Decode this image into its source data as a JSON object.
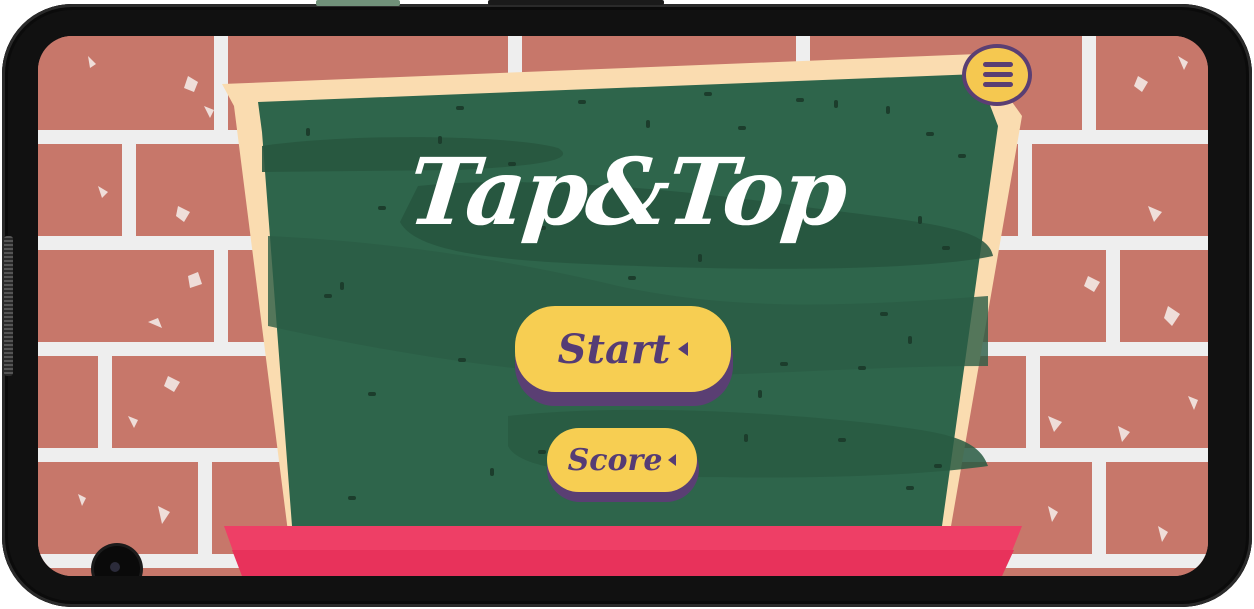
{
  "game": {
    "title": "Tap&Top"
  },
  "menu": {
    "icon": "hamburger-menu-icon"
  },
  "buttons": {
    "start_label": "Start",
    "score_label": "Score",
    "arrow_icon": "caret-left-icon"
  },
  "colors": {
    "brick": "#c7776a",
    "mortar": "#eeeeee",
    "board": "#2e654b",
    "frame": "#fadcb0",
    "ledge": "#ee3f66",
    "button": "#f7ce52",
    "button_text": "#553c75"
  }
}
